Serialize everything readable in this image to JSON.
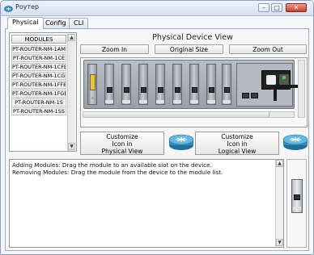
{
  "window": {
    "title": "Роутер",
    "buttons": {
      "minimize": "–",
      "maximize": "□",
      "close": "✕"
    }
  },
  "tabs": [
    {
      "label": "Physical",
      "active": true
    },
    {
      "label": "Config",
      "active": false
    },
    {
      "label": "CLI",
      "active": false
    }
  ],
  "modules": {
    "header": "MODULES",
    "items": [
      "PT-ROUTER-NM-1AM",
      "PT-ROUTER-NM-1CE",
      "PT-ROUTER-NM-1CFE",
      "PT-ROUTER-NM-1CGE",
      "PT-ROUTER-NM-1FFE",
      "PT-ROUTER-NM-1FGE",
      "PT-ROUTER-NM-1S",
      "PT-ROUTER-NM-1SS"
    ]
  },
  "physical_view": {
    "title": "Physical Device View",
    "zoom_in": "Zoom In",
    "original_size": "Original Size",
    "zoom_out": "Zoom Out"
  },
  "customize": {
    "physical_label": "Customize\nIcon in\nPhysical View",
    "logical_label": "Customize\nIcon in\nLogical View"
  },
  "info": {
    "lines": [
      "Adding Modules: Drag the module to an available slot on the device.",
      "Removing Modules: Drag the module from the device to the module list."
    ]
  },
  "colors": {
    "accent_border": "#8aa0bc",
    "router_icon": "#2f8fbf"
  },
  "icons": {
    "title": "router-icon",
    "physical_custom": "router-icon",
    "logical_custom": "router-icon"
  }
}
